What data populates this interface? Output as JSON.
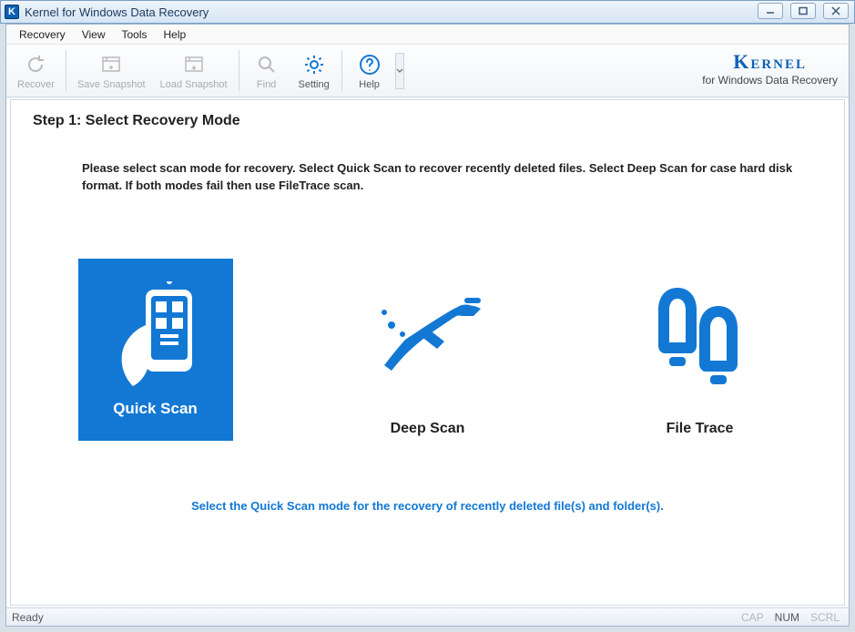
{
  "window": {
    "title": "Kernel for Windows Data Recovery"
  },
  "menu": {
    "items": [
      "Recovery",
      "View",
      "Tools",
      "Help"
    ]
  },
  "toolbar": {
    "recover": "Recover",
    "save_snapshot": "Save Snapshot",
    "load_snapshot": "Load Snapshot",
    "find": "Find",
    "setting": "Setting",
    "help": "Help"
  },
  "brand": {
    "name": "Kernel",
    "tagline": "for Windows Data Recovery"
  },
  "content": {
    "step_title": "Step 1: Select Recovery Mode",
    "instructions": "Please select scan mode for recovery. Select Quick Scan to recover recently deleted files. Select Deep Scan for case hard disk format. If both modes fail then use FileTrace scan.",
    "modes": {
      "quick": "Quick Scan",
      "deep": "Deep Scan",
      "filetrace": "File Trace"
    },
    "hint": "Select the Quick Scan mode for the recovery of recently deleted file(s) and folder(s)."
  },
  "status": {
    "left": "Ready",
    "cap": "CAP",
    "num": "NUM",
    "scrl": "SCRL"
  }
}
